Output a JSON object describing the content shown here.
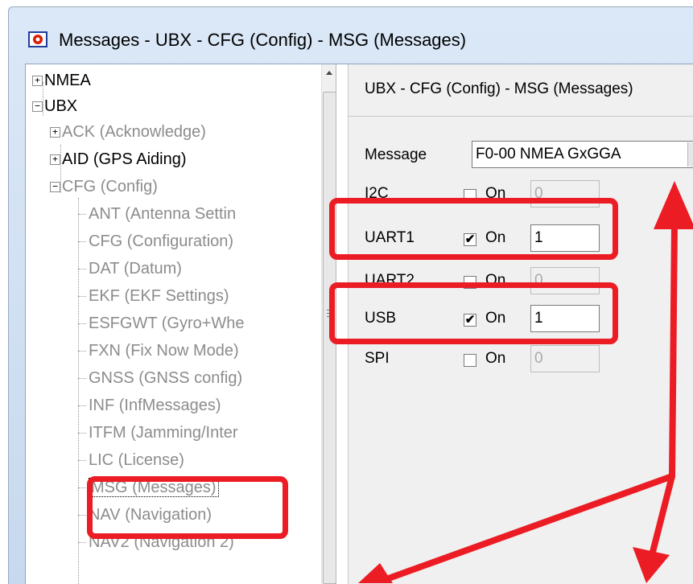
{
  "window": {
    "title": "Messages - UBX - CFG (Config) - MSG (Messages)"
  },
  "tree": {
    "items": [
      {
        "label": "NMEA",
        "expander": "+"
      },
      {
        "label": "UBX",
        "expander": "−"
      },
      {
        "label": "ACK (Acknowledge)",
        "expander": "+"
      },
      {
        "label": "AID (GPS Aiding)",
        "expander": "+"
      },
      {
        "label": "CFG (Config)",
        "expander": "−"
      },
      {
        "label": "ANT (Antenna Settin"
      },
      {
        "label": "CFG (Configuration)"
      },
      {
        "label": "DAT (Datum)"
      },
      {
        "label": "EKF (EKF Settings)"
      },
      {
        "label": "ESFGWT (Gyro+Whe"
      },
      {
        "label": "FXN (Fix Now Mode)"
      },
      {
        "label": "GNSS (GNSS config)"
      },
      {
        "label": "INF (InfMessages)"
      },
      {
        "label": "ITFM (Jamming/Inter"
      },
      {
        "label": "LIC (License)"
      },
      {
        "label": "MSG (Messages)"
      },
      {
        "label": "NAV (Navigation)"
      },
      {
        "label": "NAV2 (Navigation 2)"
      }
    ]
  },
  "panel": {
    "title": "UBX - CFG (Config) - MSG (Messages)",
    "message_label": "Message",
    "message_value": "F0-00 NMEA GxGGA",
    "on_label": "On",
    "ports": [
      {
        "name": "I2C",
        "checked": false,
        "rate": "0",
        "enabled": false
      },
      {
        "name": "UART1",
        "checked": true,
        "rate": "1",
        "enabled": true
      },
      {
        "name": "UART2",
        "checked": false,
        "rate": "0",
        "enabled": false
      },
      {
        "name": "USB",
        "checked": true,
        "rate": "1",
        "enabled": true
      },
      {
        "name": "SPI",
        "checked": false,
        "rate": "0",
        "enabled": false
      }
    ]
  },
  "colors": {
    "highlight": "#ec1c24",
    "titlebar": "#c7d9ef"
  },
  "icons": {
    "app": "ucenter-app-icon",
    "check": "✔"
  }
}
